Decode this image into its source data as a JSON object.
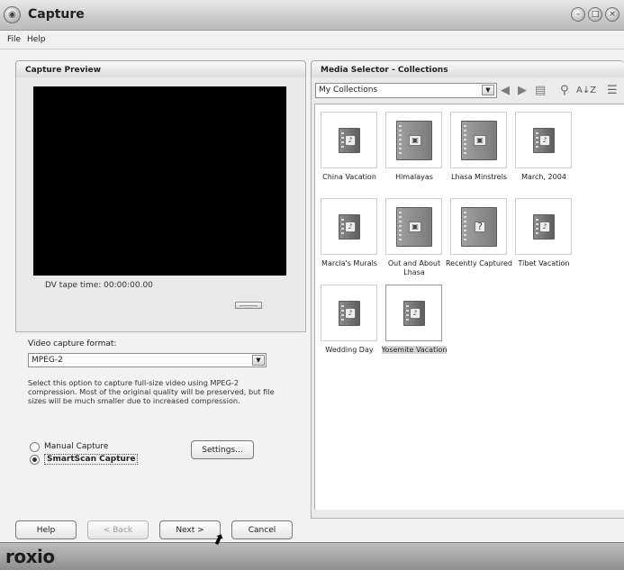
{
  "window": {
    "title": "Capture",
    "controls": [
      "minimize",
      "maximize",
      "close"
    ]
  },
  "menu": {
    "items": [
      "File",
      "Help"
    ]
  },
  "capture_preview": {
    "header": "Capture Preview",
    "tape_time_label": "DV tape time: 00:00:00.00",
    "format_label": "Video capture format:",
    "format_value": "MPEG-2",
    "description": "Select this option to capture full-size video using MPEG-2 compression. Most of the original quality will be preserved, but file sizes will be much smaller due to increased compression.",
    "modes": [
      {
        "label": "Manual Capture",
        "selected": false
      },
      {
        "label": "SmartScan Capture",
        "selected": true
      }
    ],
    "settings_button": "Settings..."
  },
  "footer_buttons": {
    "help": "Help",
    "back": "< Back",
    "next": "Next >",
    "cancel": "Cancel"
  },
  "media_selector": {
    "header": "Media Selector - Collections",
    "collection_value": "My Collections",
    "items": [
      {
        "label": "China Vacation",
        "icon": "small-book-icon",
        "selected": false
      },
      {
        "label": "Himalayas",
        "icon": "large-book-icon",
        "selected": false
      },
      {
        "label": "Lhasa Minstrels",
        "icon": "large-book-icon",
        "selected": false
      },
      {
        "label": "March, 2004",
        "icon": "small-book-icon",
        "selected": false
      },
      {
        "label": "Marcia's Murals",
        "icon": "small-book-icon",
        "selected": false
      },
      {
        "label": "Out and About Lhasa",
        "icon": "large-book-icon",
        "selected": false
      },
      {
        "label": "Recently Captured",
        "icon": "question-book-icon",
        "selected": false
      },
      {
        "label": "Tibet Vacation",
        "icon": "small-book-icon",
        "selected": false
      },
      {
        "label": "Wedding Day",
        "icon": "small-book-icon",
        "selected": false
      },
      {
        "label": "Yosemite Vacation",
        "icon": "small-book-icon",
        "selected": true
      }
    ]
  },
  "brand": {
    "logo": "roxio"
  },
  "colors": {
    "frame": "#c4c4c4",
    "preview_screen": "#000000",
    "panel_bg": "#e9e9e9"
  }
}
